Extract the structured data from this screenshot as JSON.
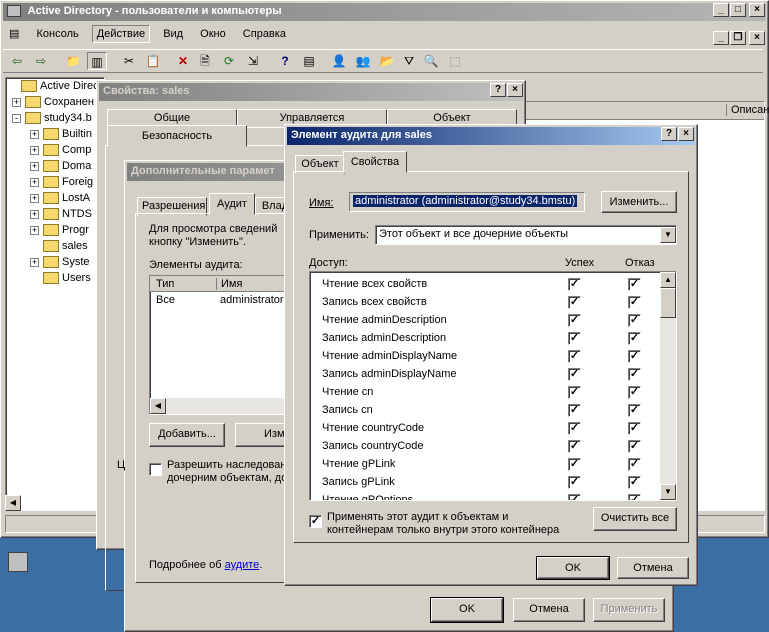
{
  "mmc": {
    "title": "Active Directory - пользователи и компьютеры",
    "menu": [
      "Консоль",
      "Действие",
      "Вид",
      "Окно",
      "Справка"
    ],
    "tree": [
      {
        "label": "Active Directo",
        "pm": ""
      },
      {
        "label": "Сохранен",
        "pm": "+"
      },
      {
        "label": "study34.b",
        "pm": "-"
      },
      {
        "label": "Builtin",
        "pm": "+"
      },
      {
        "label": "Comp",
        "pm": "+"
      },
      {
        "label": "Doma",
        "pm": "+"
      },
      {
        "label": "Foreig",
        "pm": "+"
      },
      {
        "label": "LostA",
        "pm": "+"
      },
      {
        "label": "NTDS",
        "pm": "+"
      },
      {
        "label": "Progr",
        "pm": "+"
      },
      {
        "label": "sales",
        "pm": ""
      },
      {
        "label": "Syste",
        "pm": "+"
      },
      {
        "label": "Users",
        "pm": ""
      }
    ],
    "right_col_header": "Описан"
  },
  "props": {
    "title": "Свойства: sales",
    "tabs_row1": [
      "Общие",
      "Управляется",
      "Объект"
    ],
    "tabs_row2": [
      "Безопасность"
    ],
    "ok": "OK",
    "cancel": "Отмена",
    "apply": "Применить"
  },
  "advanced": {
    "title": "Дополнительные парамет",
    "tabs": [
      "Разрешения",
      "Аудит",
      "Влад"
    ],
    "desc": "Для просмотра сведений о элементе аудита выберите его и нажмите кнопку \"Изменить\".",
    "desc_line1": "Для просмотра сведений",
    "desc_line2": "кнопку \"Изменить\".",
    "entries_label": "Элементы аудита:",
    "cols": [
      "Тип",
      "Имя"
    ],
    "rows": [
      {
        "type": "Все",
        "name": "administrator"
      }
    ],
    "add": "Добавить...",
    "edit": "Изм",
    "inherit_line1": "Разрешить наследован",
    "inherit_line2": "дочерним объектам, до",
    "more_text": "Подробнее об ",
    "more_link": "аудите",
    "more_dot": ".",
    "stub1": "Ц",
    "stub2": "п"
  },
  "audit": {
    "title": "Элемент аудита для sales",
    "tabs": [
      "Объект",
      "Свойства"
    ],
    "name_label": "Имя:",
    "name_value": "administrator (administrator@study34.bmstu)",
    "change": "Изменить...",
    "apply_label": "Применить:",
    "apply_value": "Этот объект и все дочерние объекты",
    "access_label": "Доступ:",
    "success_label": "Успех",
    "fail_label": "Отказ",
    "perms": [
      "Чтение всех свойств",
      "Запись всех свойств",
      "Чтение adminDescription",
      "Запись adminDescription",
      "Чтение adminDisplayName",
      "Запись adminDisplayName",
      "Чтение cn",
      "Запись cn",
      "Чтение countryCode",
      "Запись countryCode",
      "Чтение gPLink",
      "Запись gPLink",
      "Чтение gPOptions"
    ],
    "apply_only_line1": "Применять этот аудит к объектам и",
    "apply_only_line2": "контейнерам только внутри этого контейнера",
    "clear_all": "Очистить все",
    "ok": "OK",
    "cancel": "Отмена"
  }
}
